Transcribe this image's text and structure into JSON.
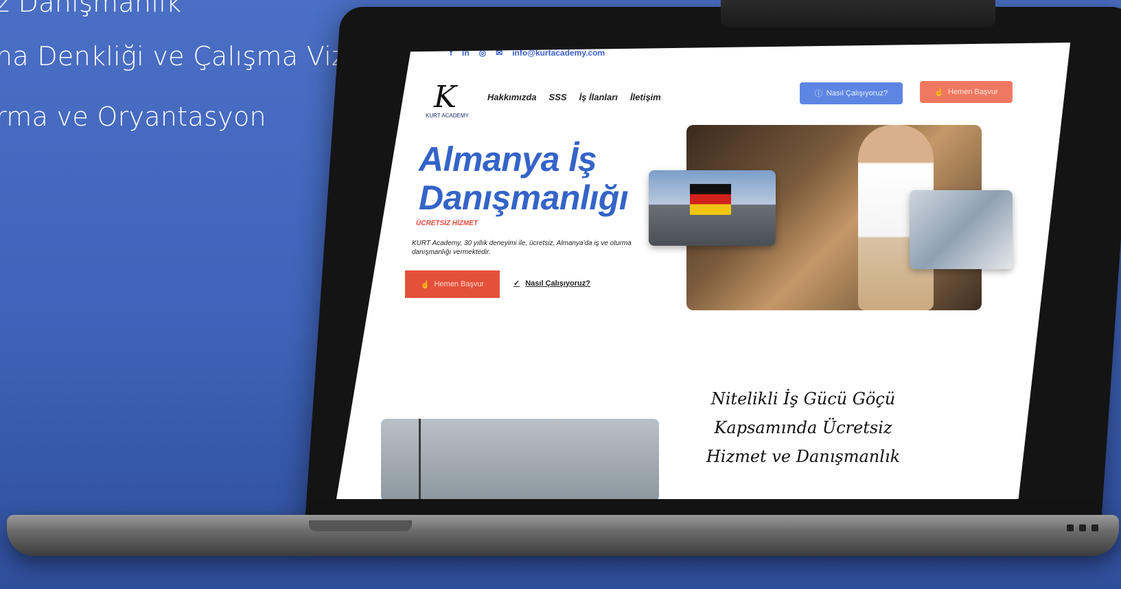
{
  "promo": {
    "line1": "z Danışmanlık",
    "line2": "na Denkliği ve Çalışma Vizesi",
    "line3": "rma ve Oryantasyon"
  },
  "site": {
    "topbar": {
      "facebook": "f",
      "linkedin": "in",
      "instagram": "◎",
      "mail_icon": "✉",
      "email": "info@kurtacademy.com"
    },
    "logo": {
      "mark": "K",
      "text": "KURT ACADEMY"
    },
    "nav": [
      "Hakkımızda",
      "SSS",
      "İş İlanları",
      "İletişim"
    ],
    "header_buttons": {
      "secondary": "Nasıl Çalışıyoruz?",
      "primary": "Hemen Başvur"
    },
    "hero": {
      "title_line1": "Almanya İş",
      "title_line2": "Danışmanlığı",
      "tag": "ÜCRETSİZ HİZMET",
      "description": "KURT Academy, 30 yıllık deneyimi ile, ücretsiz, Almanya'da iş ve oturma danışmanlığı vermektedir.",
      "cta": "Hemen Başvur",
      "link": "Nasıl Çalışıyoruz?"
    },
    "section": {
      "line1": "Nitelikli İş Gücü Göçü",
      "line2": "Kapsamında Ücretsiz",
      "line3": "Hizmet ve Danışmanlık"
    }
  },
  "colors": {
    "background": "#4a6fc4",
    "brand_blue": "#3464c8",
    "accent_red": "#e5503a"
  }
}
